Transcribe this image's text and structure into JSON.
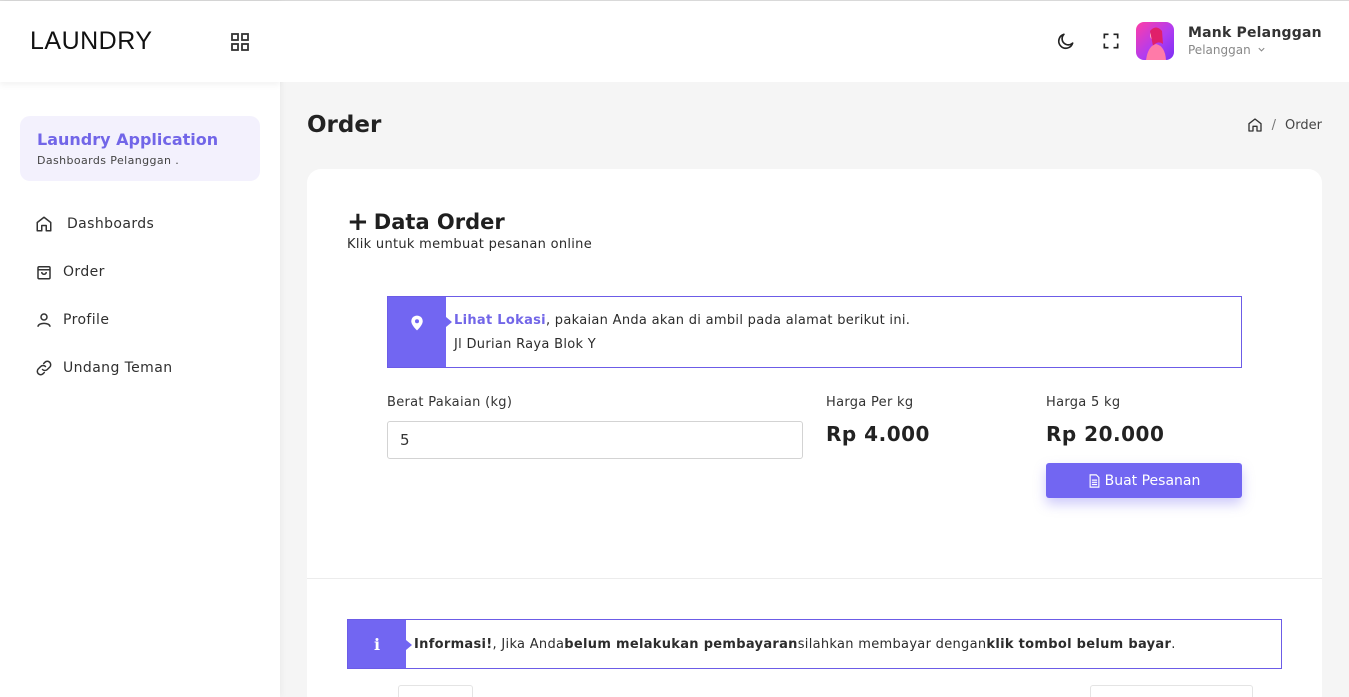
{
  "sidebar": {
    "brand": "LAUNDRY",
    "app_card": {
      "title": "Laundry Application",
      "subtitle": "Dashboards Pelanggan ."
    },
    "items": [
      {
        "label": "Dashboards",
        "icon": "home-icon"
      },
      {
        "label": "Order",
        "icon": "shopping-bag-icon"
      },
      {
        "label": "Profile",
        "icon": "user-icon"
      },
      {
        "label": "Undang Teman",
        "icon": "link-icon"
      }
    ]
  },
  "header": {
    "user_name": "Mank Pelanggan",
    "user_role": "Pelanggan"
  },
  "page": {
    "title": "Order",
    "breadcrumb": [
      "home",
      "Order"
    ]
  },
  "card": {
    "title": "Data Order",
    "subtitle": "Klik untuk membuat pesanan online",
    "location_alert": {
      "link": "Lihat Lokasi",
      "text": ", pakaian Anda akan di ambil pada alamat berikut ini.",
      "address": "Jl Durian Raya Blok Y"
    },
    "weight_label": "Berat Pakaian (kg)",
    "weight_value": "5",
    "price_per_kg_label": "Harga Per kg",
    "price_per_kg": "Rp 4.000",
    "total_label": "Harga 5 kg",
    "total": "Rp 20.000",
    "order_button": "Buat Pesanan",
    "info_alert": {
      "strong1": "Informasi!",
      "text1": ", Jika Anda ",
      "strong2": "belum melakukan pembayaran",
      "text2": " silahkan membayar dengan ",
      "strong3": "klik tombol belum bayar",
      "text3": "."
    }
  },
  "colors": {
    "accent": "#7266f2",
    "accent_text": "#7266e8",
    "app_card_bg": "#f3f1fd"
  }
}
